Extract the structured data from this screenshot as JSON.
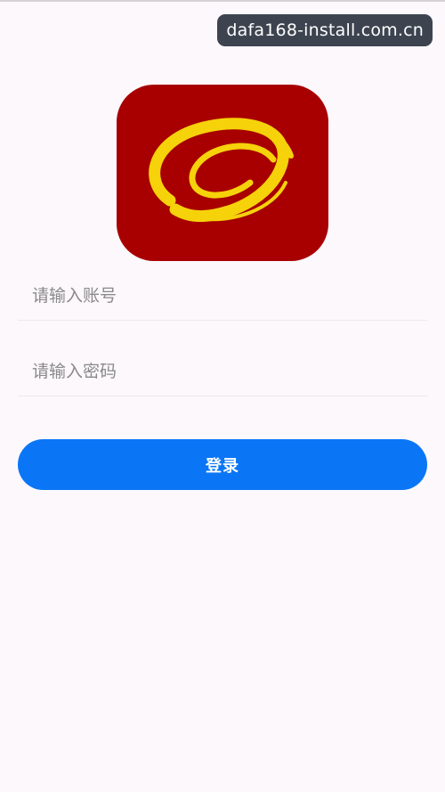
{
  "watermark": {
    "text": "dafa168-install.com.cn"
  },
  "logo": {
    "icon": "dafa-ring-logo",
    "background_color": "#a80000",
    "ring_color": "#f5d20a"
  },
  "login_form": {
    "account_placeholder": "请输入账号",
    "account_value": "",
    "password_placeholder": "请输入密码",
    "password_value": "",
    "login_label": "登录",
    "button_color": "#0a76f6"
  }
}
